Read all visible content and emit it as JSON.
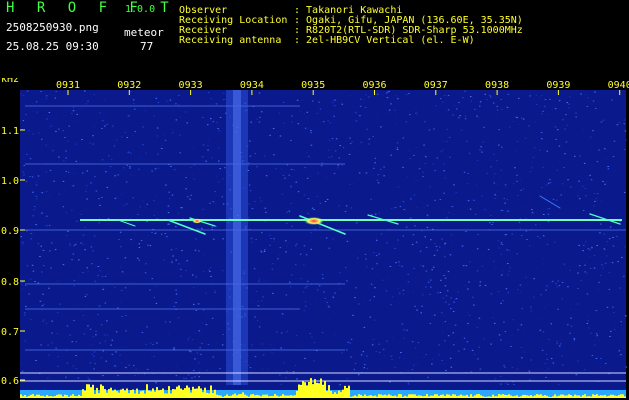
{
  "app": {
    "name": "H R O F F T",
    "version": "1.0.0"
  },
  "file": {
    "name": "2508250930.png"
  },
  "timestamp": "25.08.25 09:30",
  "meteor": {
    "label": "meteor",
    "count": "77"
  },
  "info": [
    {
      "key": "Observer",
      "value": ": Takanori Kawachi"
    },
    {
      "key": "Receiving Location",
      "value": ": Ogaki, Gifu, JAPAN (136.60E, 35.35N)"
    },
    {
      "key": "Receiver",
      "value": ": R820T2(RTL-SDR) SDR-Sharp 53.1000MHz"
    },
    {
      "key": "Receiving antenna",
      "value": ": 2el-HB9CV Vertical (el. E-W)"
    }
  ],
  "axes": {
    "y_unit": "kHz",
    "y_ticks": [
      "1.1",
      "1.0",
      "0.9",
      "0.8",
      "0.7",
      "0.6"
    ],
    "x_ticks": [
      "0931",
      "0932",
      "0933",
      "0934",
      "0935",
      "0936",
      "0937",
      "0938",
      "0939",
      "0940"
    ]
  },
  "colors": {
    "background": "#000000",
    "spectrum": "#0a1a8c",
    "text_green": "#43ff43",
    "text_yellow": "#ffff2a"
  }
}
